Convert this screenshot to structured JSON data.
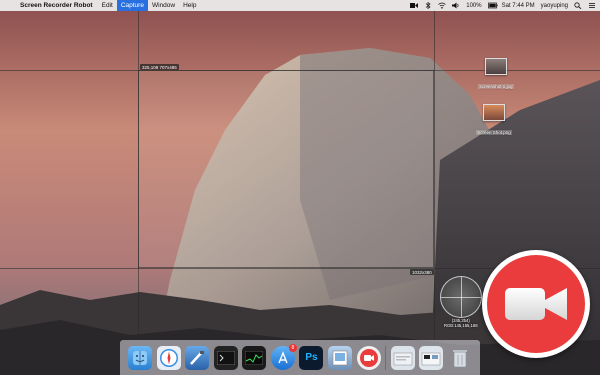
{
  "menubar": {
    "app_name": "Screen Recorder Robot",
    "menus": [
      "Edit",
      "Capture",
      "Window",
      "Help"
    ],
    "active_menu": "Capture",
    "battery": "100%",
    "clock": "Sat 7:44 PM",
    "user": "yaoyuping"
  },
  "overlay": {
    "size_top": "325,108   707x485",
    "size_bottom": "1032x380",
    "magnifier_coords": "(245,254)",
    "magnifier_rgb": "RGB:145,155,168"
  },
  "desktop_files": [
    {
      "name": "screenshot-x.jpg"
    },
    {
      "name": "Screen Shot.png"
    }
  ],
  "dock": {
    "items": [
      {
        "name": "finder-icon"
      },
      {
        "name": "safari-icon"
      },
      {
        "name": "xcode-icon"
      },
      {
        "name": "terminal-icon"
      },
      {
        "name": "activity-monitor-icon"
      },
      {
        "name": "app-store-icon",
        "badge": "8"
      },
      {
        "name": "photoshop-icon",
        "label": "Ps"
      },
      {
        "name": "preview-icon"
      },
      {
        "name": "screen-recorder-icon"
      },
      {
        "name": "folder-icon"
      },
      {
        "name": "downloads-icon"
      },
      {
        "name": "trash-icon"
      }
    ]
  },
  "colors": {
    "record_red": "#ea3c3c",
    "menu_highlight": "#2a6fe0"
  }
}
